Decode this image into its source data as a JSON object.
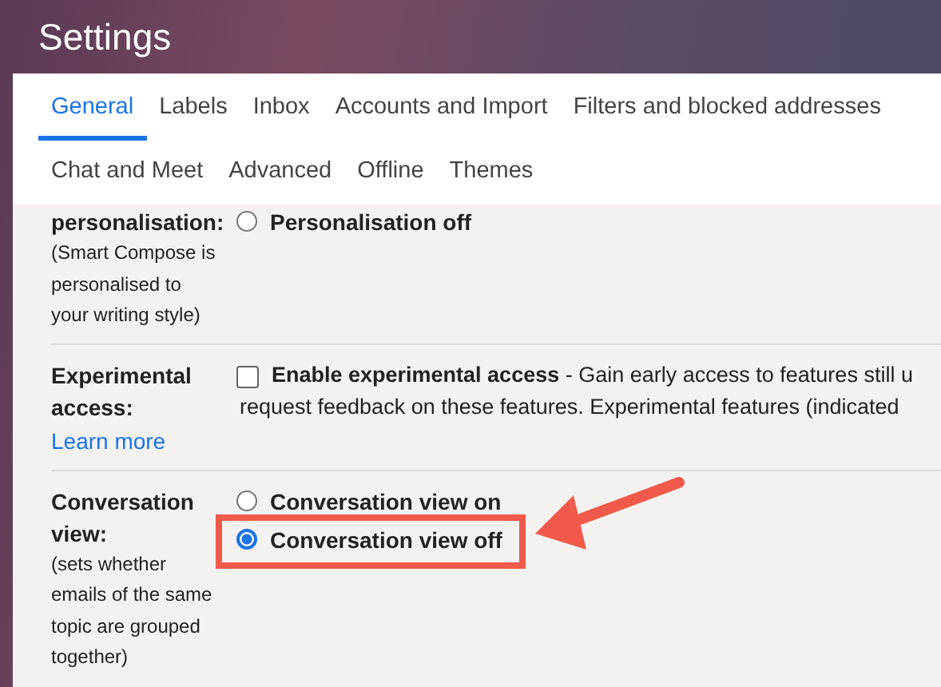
{
  "window": {
    "title": "Settings"
  },
  "tab_rows": [
    {
      "tabs": [
        {
          "label": "General",
          "selected": true
        },
        {
          "label": "Labels",
          "selected": false
        },
        {
          "label": "Inbox",
          "selected": false
        },
        {
          "label": "Accounts and Import",
          "selected": false
        },
        {
          "label": "Filters and blocked addresses",
          "selected": false
        }
      ]
    },
    {
      "tabs": [
        {
          "label": "Chat and Meet",
          "selected": false
        },
        {
          "label": "Advanced",
          "selected": false
        },
        {
          "label": "Offline",
          "selected": false
        },
        {
          "label": "Themes",
          "selected": false
        }
      ]
    }
  ],
  "sections": [
    {
      "label": "personalisation:",
      "description": "(Smart Compose is personalised to your writing style)",
      "options": [
        {
          "kind": "radio",
          "label": "Personalisation off",
          "selected": false
        }
      ]
    },
    {
      "label": "Experimental access:",
      "link": "Learn more",
      "options": [
        {
          "kind": "checkbox",
          "checked": false,
          "text_lines": [
            "**Enable experimental access** - Gain early access to features still u",
            "request feedback on these features. Experimental features (indicated"
          ]
        }
      ]
    },
    {
      "label": "Conversation view:",
      "description": "(sets whether emails of the same topic are grouped together)",
      "options": [
        {
          "kind": "radio",
          "label": "Conversation view on",
          "selected": false
        },
        {
          "kind": "radio",
          "label": "Conversation view off",
          "selected": true
        }
      ]
    }
  ]
}
